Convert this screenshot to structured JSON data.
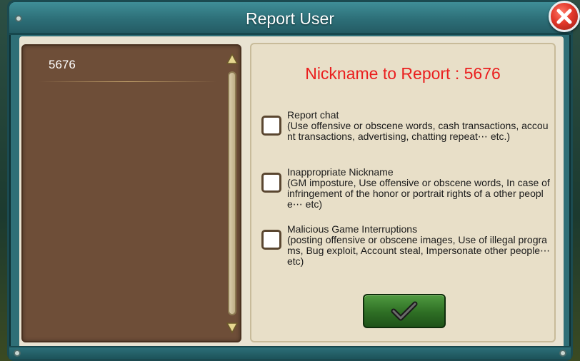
{
  "window": {
    "title": "Report User"
  },
  "user_list": {
    "items": [
      {
        "label": "5676"
      }
    ]
  },
  "report": {
    "nickname_title": "Nickname to Report : 5676",
    "options": [
      {
        "heading": "Report chat",
        "description": "(Use offensive or obscene words, cash transactions, account transactions, advertising, chatting repeat⋯ etc.)"
      },
      {
        "heading": "Inappropriate Nickname",
        "description": "(GM imposture, Use offensive or obscene words, In case of infringement of the honor or portrait rights of a other people⋯ etc)"
      },
      {
        "heading": "Malicious Game Interruptions",
        "description": "(posting offensive or obscene images, Use of illegal programs, Bug exploit, Account steal, Impersonate other people⋯ etc)"
      }
    ]
  },
  "icons": {
    "close": "close-x-icon",
    "confirm": "checkmark-icon",
    "scroll_up": "triangle-up-icon",
    "scroll_down": "triangle-down-icon"
  },
  "colors": {
    "frame": "#2f6f77",
    "list_panel": "#6e4e38",
    "accent_red": "#ea1f1f",
    "confirm_green": "#2e6e24"
  }
}
